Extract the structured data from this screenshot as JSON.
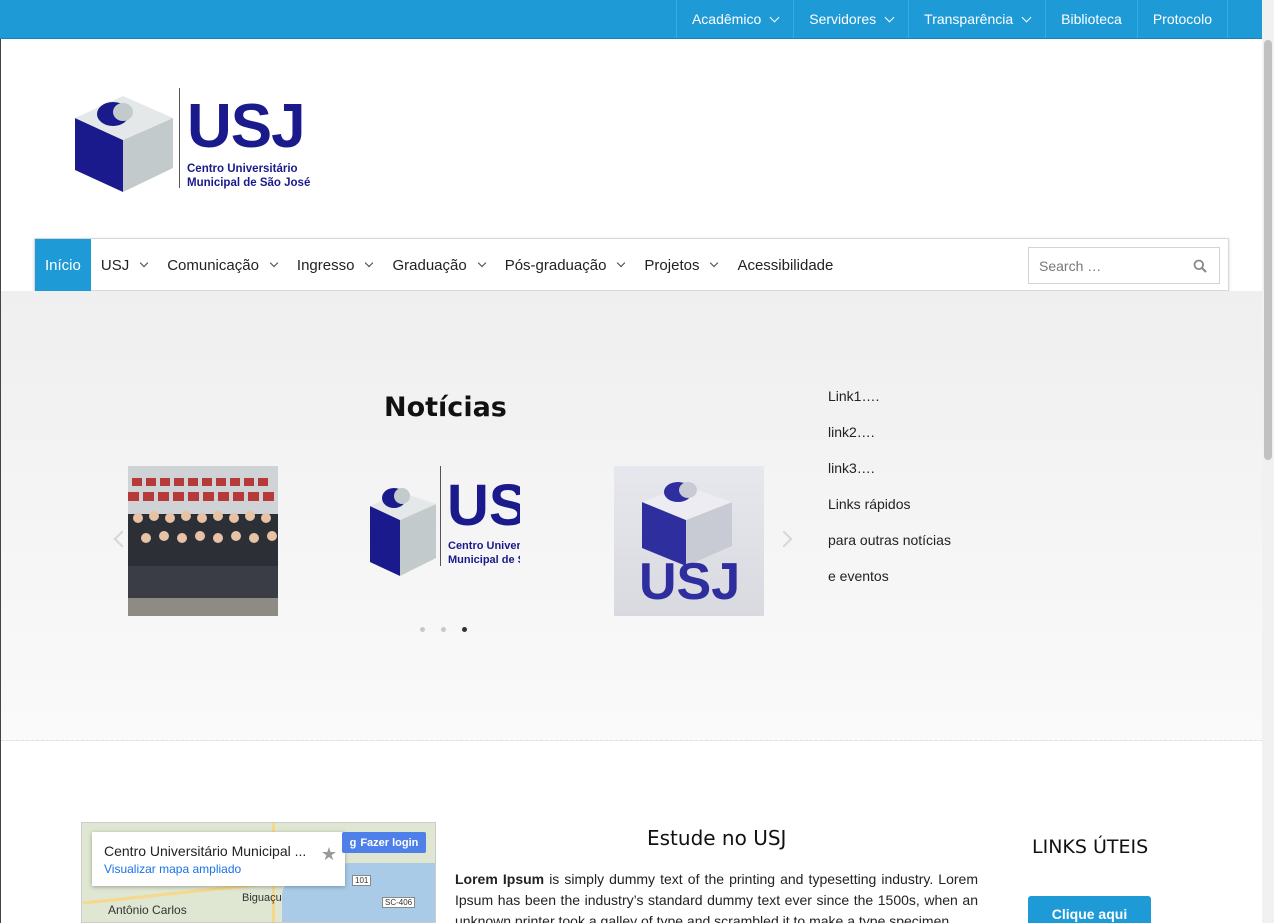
{
  "topbar": {
    "items": [
      {
        "label": "Acadêmico",
        "has_dropdown": true
      },
      {
        "label": "Servidores",
        "has_dropdown": true
      },
      {
        "label": "Transparência",
        "has_dropdown": true
      },
      {
        "label": "Biblioteca",
        "has_dropdown": false
      },
      {
        "label": "Protocolo",
        "has_dropdown": false
      }
    ]
  },
  "logo": {
    "title": "USJ",
    "subtitle_line1": "Centro Universitário",
    "subtitle_line2": "Municipal de São José"
  },
  "mainnav": {
    "items": [
      {
        "label": "Início",
        "active": true
      },
      {
        "label": "USJ",
        "has_dropdown": true
      },
      {
        "label": "Comunicação",
        "has_dropdown": true
      },
      {
        "label": "Ingresso",
        "has_dropdown": true
      },
      {
        "label": "Graduação",
        "has_dropdown": true
      },
      {
        "label": "Pós-graduação",
        "has_dropdown": true
      },
      {
        "label": "Projetos",
        "has_dropdown": true
      },
      {
        "label": "Acessibilidade",
        "has_dropdown": false
      }
    ],
    "search_placeholder": "Search …"
  },
  "hero": {
    "title": "Notícias",
    "active_slide": 3,
    "slide2_logo_text": "US",
    "slide2_logo_sub1": "Centro Univers",
    "slide2_logo_sub2": "Municipal de S",
    "slide3_logo_text": "USJ",
    "links": [
      "Link1….",
      "link2….",
      "link3….",
      "Links rápidos",
      "para outras notícias",
      "e eventos"
    ]
  },
  "map": {
    "title": "Centro Universitário Municipal ...",
    "link": "Visualizar mapa ampliado",
    "login": "Fazer login",
    "places": [
      "Biguaçu",
      "Antônio Carlos"
    ],
    "shields": [
      "SC-406",
      "101"
    ]
  },
  "estude": {
    "title": "Estude no USJ",
    "text_bold": "Lorem Ipsum",
    "text": " is simply dummy text of the printing and typesetting industry. Lorem Ipsum has been the industry’s standard dummy text ever since the 1500s, when an unknown printer took a galley of type and scrambled it to make a type specimen"
  },
  "links_uteis": {
    "title": "LINKS ÚTEIS",
    "button": "Clique aqui"
  },
  "colors": {
    "primary": "#1e9ad6",
    "brand_navy": "#1a1a8c",
    "brand_gray": "#c3cacc"
  }
}
